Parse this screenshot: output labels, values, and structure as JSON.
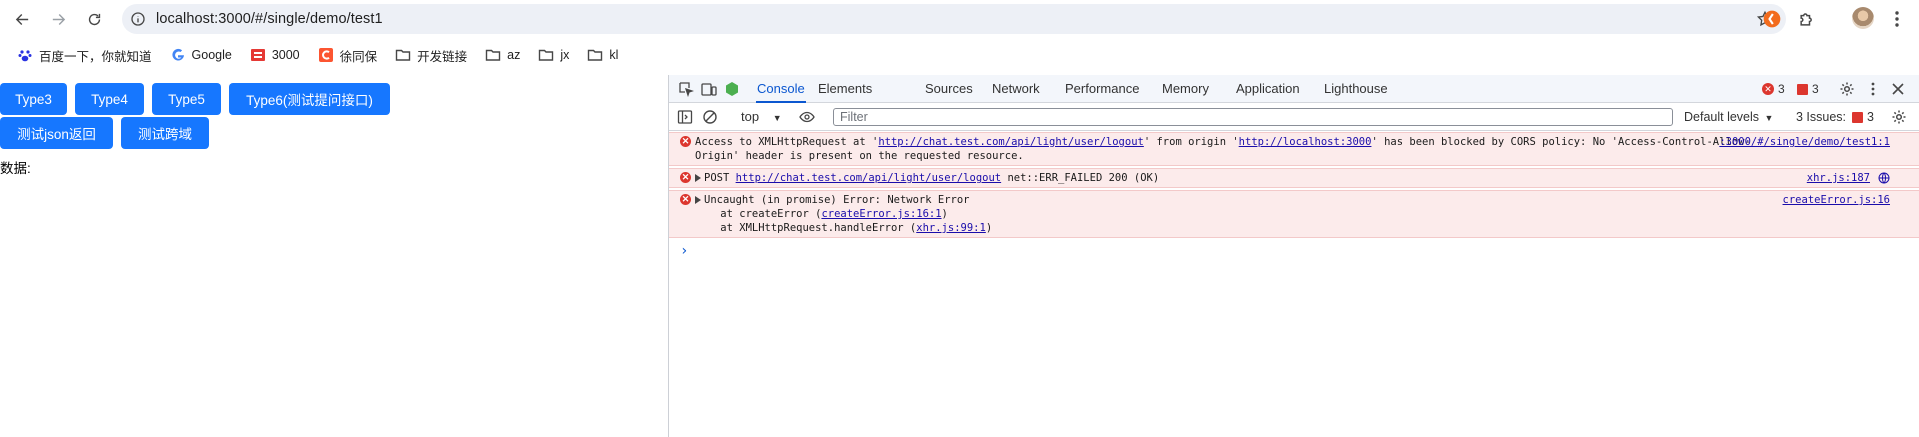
{
  "browser": {
    "url": "localhost:3000/#/single/demo/test1"
  },
  "bookmarks": [
    {
      "label": "百度一下，你就知道",
      "icon": "baidu-paw-icon"
    },
    {
      "label": "Google",
      "icon": "google-g-icon"
    },
    {
      "label": "3000",
      "icon": "red-square-icon"
    },
    {
      "label": "徐同保",
      "icon": "csdn-c-icon"
    },
    {
      "label": "开发链接",
      "icon": "folder-icon"
    },
    {
      "label": "az",
      "icon": "folder-icon"
    },
    {
      "label": "jx",
      "icon": "folder-icon"
    },
    {
      "label": "kl",
      "icon": "folder-icon"
    }
  ],
  "page": {
    "row1": [
      "Type3",
      "Type4",
      "Type5",
      "Type6(测试提问接口)"
    ],
    "row2": [
      "测试json返回",
      "测试跨域"
    ],
    "data_label": "数据:"
  },
  "devtools": {
    "tabs": [
      "Console",
      "Elements",
      "Sources",
      "Network",
      "Performance",
      "Memory",
      "Application",
      "Lighthouse"
    ],
    "active_tab": "Console",
    "error_count": "3",
    "issue_flag_count": "3",
    "context": "top",
    "filter_placeholder": "Filter",
    "levels": "Default levels",
    "issues_label": "3 Issues:",
    "issues_count": "3",
    "messages": {
      "m1_line1_a": "Access to XMLHttpRequest at '",
      "m1_link1": "http://chat.test.com/api/light/user/logout",
      "m1_line1_b": "' from origin '",
      "m1_link2": "http://localhost:3000",
      "m1_line1_c": "' has been blocked by CORS policy: No 'Access-Control-Allow-",
      "m1_line2": "Origin' header is present on the requested resource.",
      "m1_src": ":3000/#/single/demo/test1:1",
      "m2_a": "POST ",
      "m2_link": "http://chat.test.com/api/light/user/logout",
      "m2_b": " net::ERR_FAILED 200 (OK)",
      "m2_src": "xhr.js:187",
      "m3_line1": "Uncaught (in promise) Error: Network Error",
      "m3_line2_a": "    at createError (",
      "m3_line2_link": "createError.js:16:1",
      "m3_line2_b": ")",
      "m3_line3_a": "    at XMLHttpRequest.handleError (",
      "m3_line3_link": "xhr.js:99:1",
      "m3_line3_b": ")",
      "m3_src": "createError.js:16"
    }
  },
  "colors": {
    "button_blue": "#1677ff",
    "error_red": "#dc362e",
    "error_bg": "#fcebeb",
    "active_tab": "#0b57d0"
  }
}
